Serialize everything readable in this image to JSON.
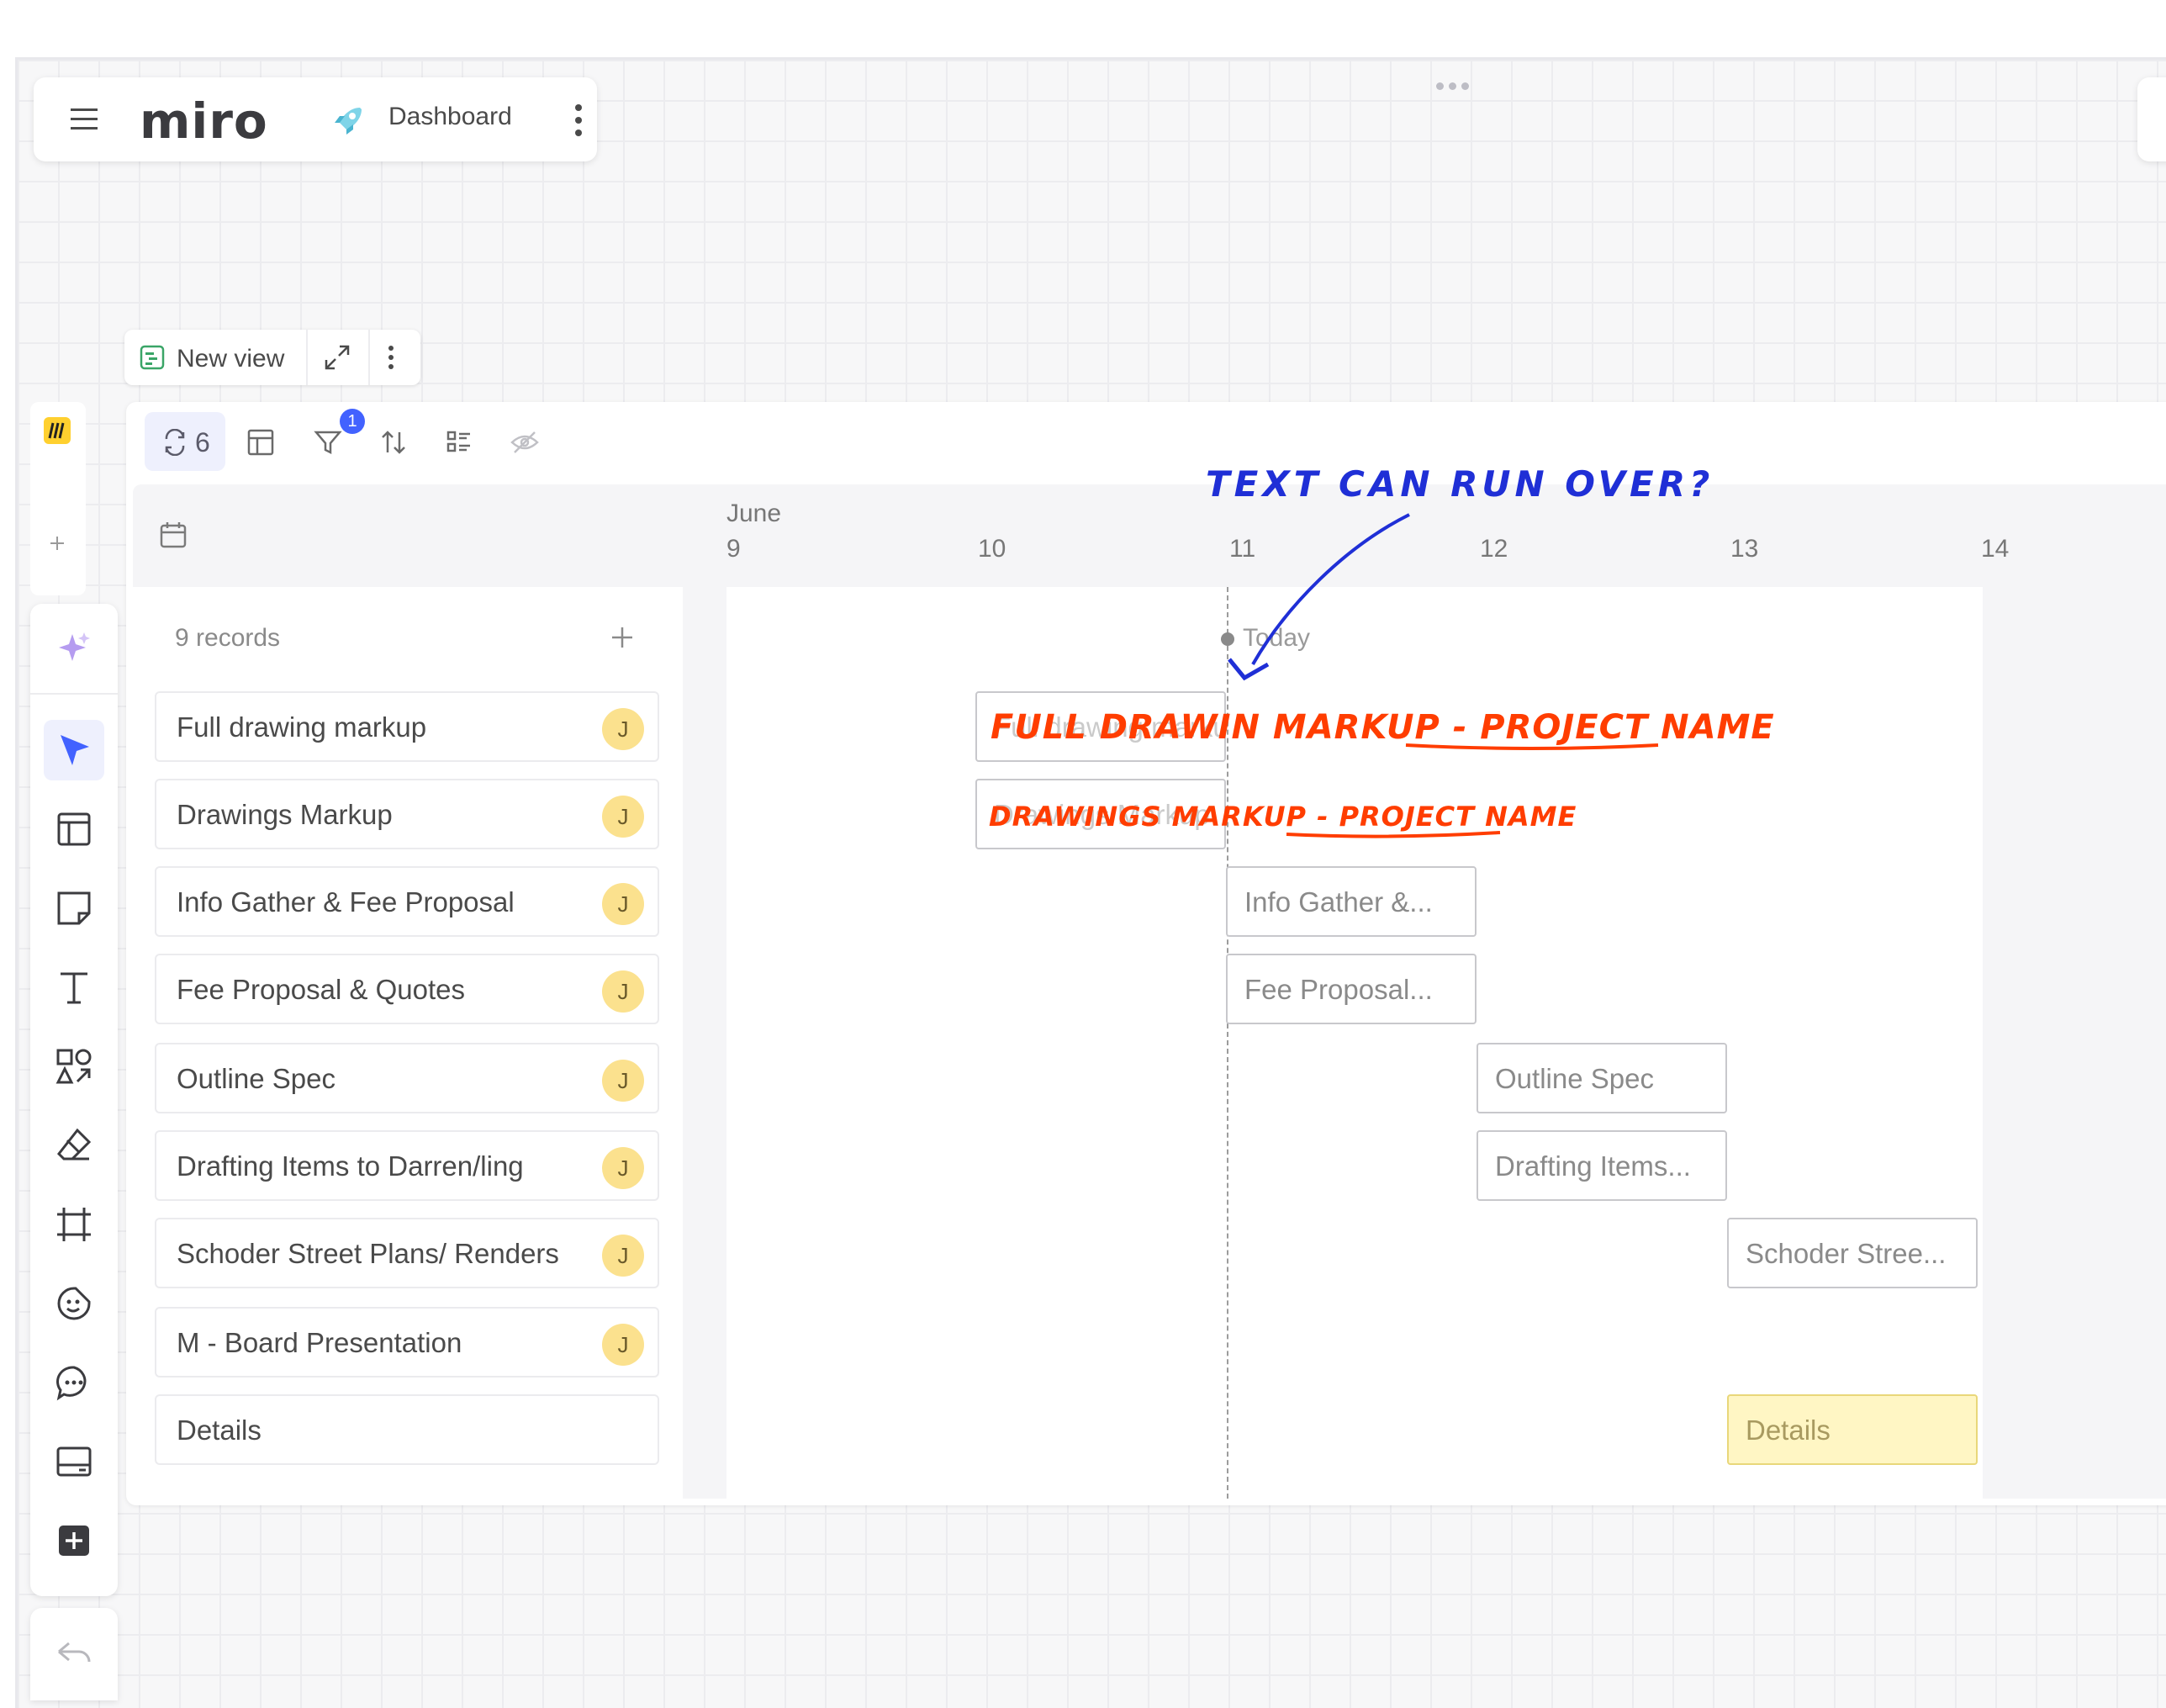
{
  "app": {
    "logo": "miro",
    "board_title": "Dashboard"
  },
  "view": {
    "label": "New view"
  },
  "toolbar": {
    "group_count": "6",
    "filter_badge": "1"
  },
  "timeline": {
    "month": "June",
    "days": [
      "9",
      "10",
      "11",
      "12",
      "13",
      "14"
    ],
    "today_label": "Today"
  },
  "records": {
    "count_label": "9 records",
    "items": [
      {
        "label": "Full drawing markup",
        "avatar": "J"
      },
      {
        "label": "Drawings Markup",
        "avatar": "J"
      },
      {
        "label": "Info Gather & Fee Proposal",
        "avatar": "J"
      },
      {
        "label": "Fee Proposal & Quotes",
        "avatar": "J"
      },
      {
        "label": "Outline Spec",
        "avatar": "J"
      },
      {
        "label": "Drafting Items to Darren/ling",
        "avatar": "J"
      },
      {
        "label": "Schoder Street Plans/ Renders",
        "avatar": "J"
      },
      {
        "label": "M - Board Presentation",
        "avatar": "J"
      },
      {
        "label": "Details",
        "avatar": ""
      }
    ]
  },
  "bars": [
    {
      "label": "Full drawing markup"
    },
    {
      "label": "Drawings Markup"
    },
    {
      "label": "Info Gather &..."
    },
    {
      "label": "Fee Proposal..."
    },
    {
      "label": "Outline Spec"
    },
    {
      "label": "Drafting Items..."
    },
    {
      "label": "Schoder Stree..."
    },
    {
      "label": "Details"
    }
  ],
  "annotations": {
    "question": "TEXT CAN RUN OVER?",
    "bar1_note": "FULL DRAWIN MARKUP - PROJECT NAME",
    "bar2_note": "DRAWINGS MARKUP - PROJECT NAME"
  },
  "colors": {
    "accent": "#4262ff",
    "avatar": "#fbe18e",
    "annotation_red": "#ff3d00",
    "annotation_blue": "#1f2fd6",
    "details_bar": "#fff6c4"
  }
}
